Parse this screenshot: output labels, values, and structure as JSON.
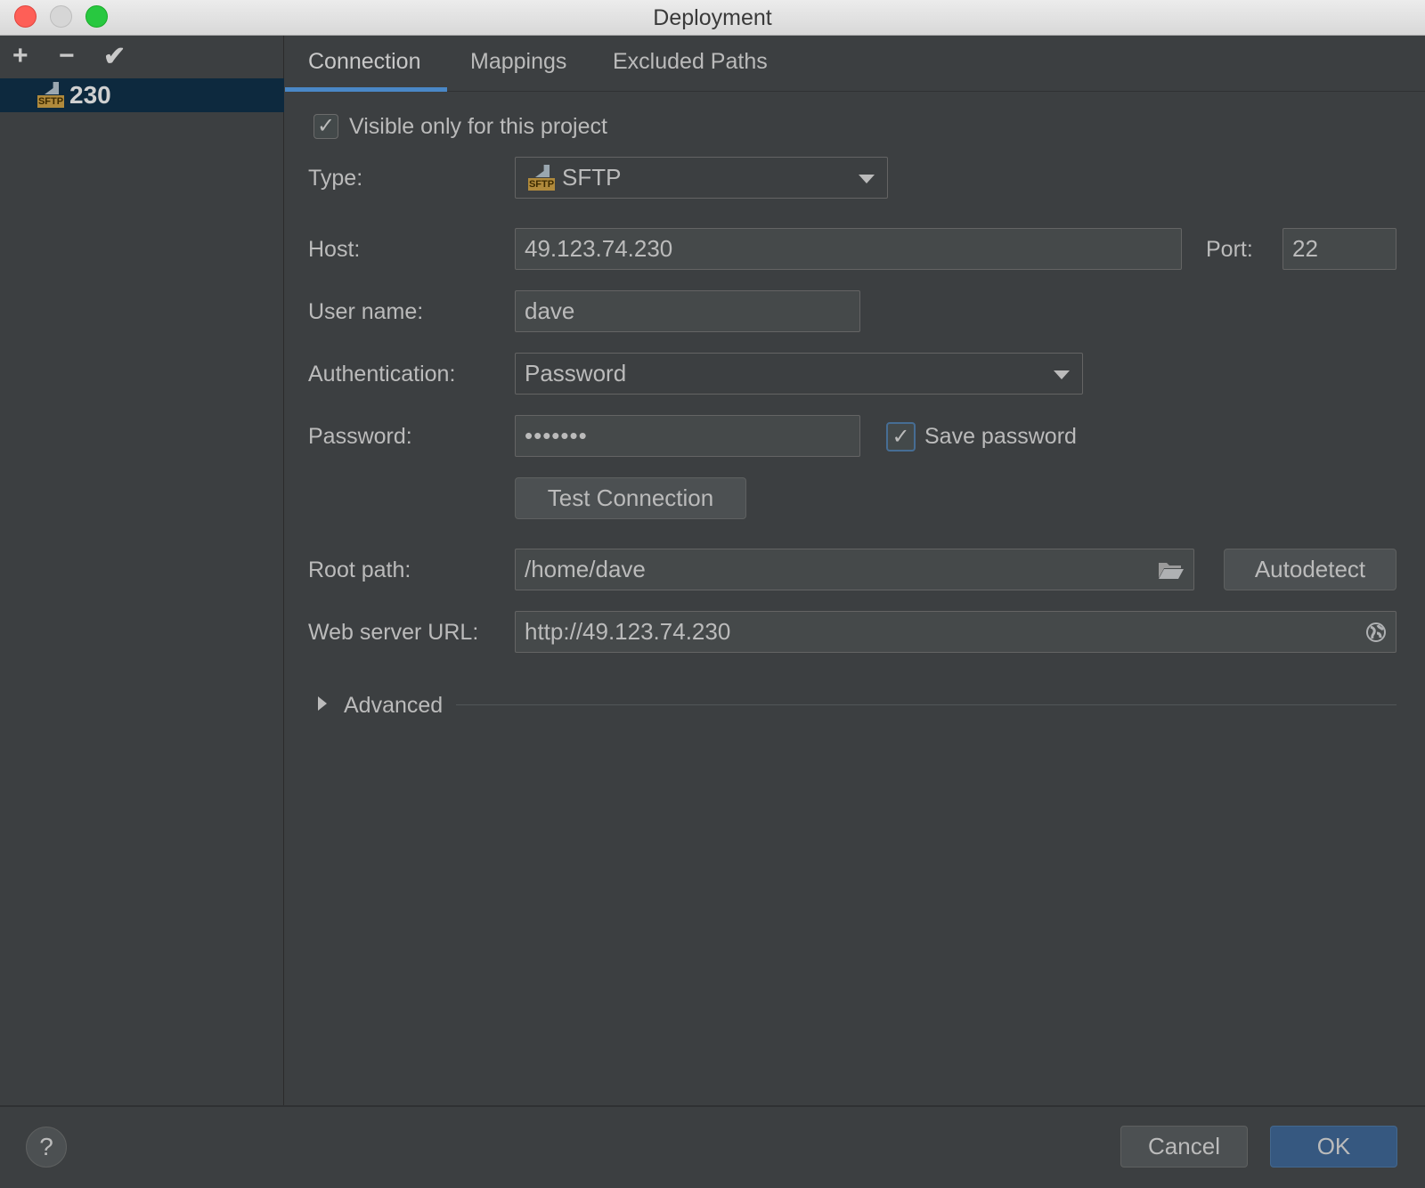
{
  "window": {
    "title": "Deployment"
  },
  "sidebar": {
    "toolbar": {
      "add": "+",
      "remove": "−",
      "apply": "✔"
    },
    "servers": [
      {
        "name": "230",
        "icon": "sftp-icon",
        "icon_text": "SFTP",
        "selected": true
      }
    ]
  },
  "tabs": [
    {
      "label": "Connection",
      "active": true
    },
    {
      "label": "Mappings",
      "active": false
    },
    {
      "label": "Excluded Paths",
      "active": false
    }
  ],
  "form": {
    "visible_only": {
      "label": "Visible only for this project",
      "checked": true
    },
    "type": {
      "label": "Type:",
      "value": "SFTP",
      "icon_text": "SFTP"
    },
    "host": {
      "label": "Host:",
      "value": "49.123.74.230"
    },
    "port": {
      "label": "Port:",
      "value": "22"
    },
    "username": {
      "label": "User name:",
      "value": "dave"
    },
    "auth": {
      "label": "Authentication:",
      "value": "Password"
    },
    "password": {
      "label": "Password:",
      "value": "•••••••"
    },
    "save_password": {
      "label": "Save password",
      "checked": true
    },
    "test_connection": "Test Connection",
    "root_path": {
      "label": "Root path:",
      "value": "/home/dave"
    },
    "autodetect": "Autodetect",
    "web_url": {
      "label": "Web server URL:",
      "value": "http://49.123.74.230"
    },
    "advanced": "Advanced"
  },
  "footer": {
    "help": "?",
    "cancel": "Cancel",
    "ok": "OK"
  },
  "colors": {
    "accent": "#4a88c7",
    "selection": "#0d293e",
    "ok_button": "#365880",
    "background": "#3c3f41"
  }
}
